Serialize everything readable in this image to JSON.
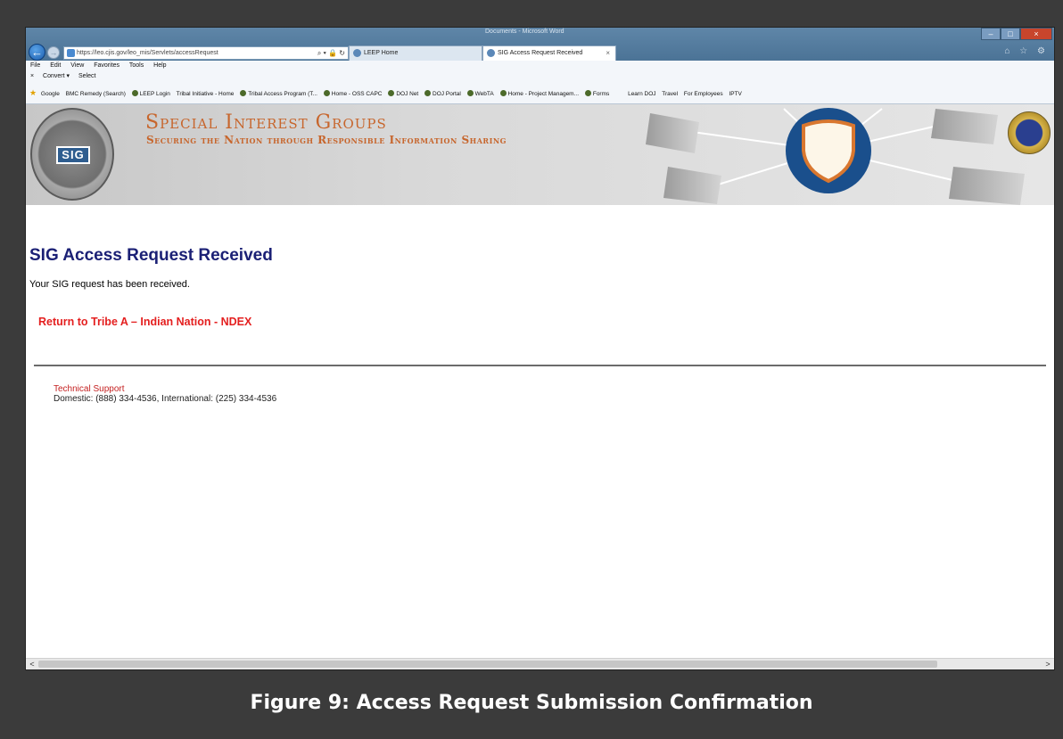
{
  "browser": {
    "window_title": "Documents - Microsoft Word",
    "address": "https://leo.cjis.gov/leo_mis/Servlets/accessRequest",
    "address_tools": "⌕ ▾ 🔒 ↻",
    "tabs": [
      {
        "label": "LEEP Home"
      },
      {
        "label": "SIG Access Request Received"
      }
    ],
    "tab_close": "×",
    "menu": [
      "File",
      "Edit",
      "View",
      "Favorites",
      "Tools",
      "Help"
    ],
    "command_bar": [
      "×",
      "Convert ▾",
      "Select"
    ],
    "favorites": [
      "Google",
      "BMC Remedy (Search)",
      "LEEP Login",
      "Tribal Initiative - Home",
      "Tribal Access Program (T...",
      "Home - OSS CAPC",
      "DOJ Net",
      "DOJ Portal",
      "WebTA",
      "Home - Project Managem...",
      "Forms",
      "Learn DOJ",
      "Travel",
      "For Employees",
      "IPTV"
    ],
    "right_icons": "⌂ ☆ ⚙",
    "back": "←",
    "forward": "→",
    "window_controls": {
      "min": "–",
      "max": "□",
      "close": "×"
    }
  },
  "banner": {
    "title": "Special Interest Groups",
    "subtitle": "Securing the Nation through Responsible Information Sharing",
    "logo_text": "SIG"
  },
  "page": {
    "heading": "SIG Access Request Received",
    "confirmation": "Your SIG request has been received.",
    "return_link": "Return to Tribe A – Indian Nation - NDEX",
    "support_label": "Technical Support",
    "support_phone": "Domestic: (888) 334-4536, International: (225) 334-4536"
  },
  "scrollbar": {
    "left": "<",
    "right": ">"
  },
  "caption": "Figure 9: Access Request Submission Confirmation",
  "colors": {
    "heading": "#1b2075",
    "link": "#e41f1f",
    "banner_text": "#c7662d",
    "support_label": "#c41f1f"
  }
}
